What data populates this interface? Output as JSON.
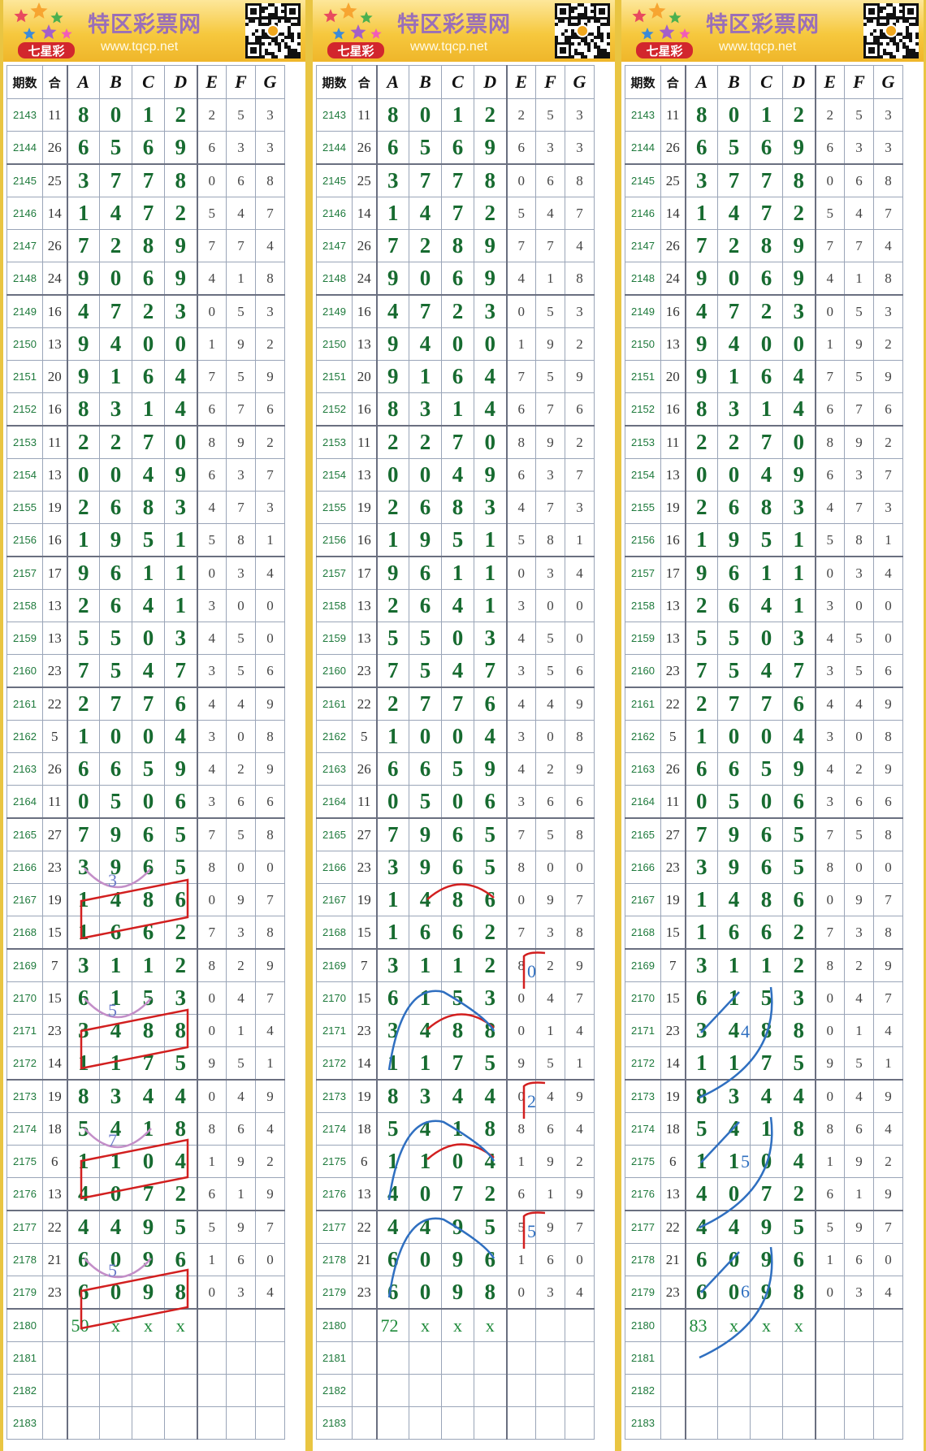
{
  "banner": {
    "title": "特区彩票网",
    "url": "www.tqcp.net",
    "logo_text": "七星彩",
    "logo_icon": "colorful-stars-logo",
    "qr_icon": "qr-code-icon"
  },
  "colors": {
    "digit_green": "#176b30",
    "period_green": "#1e7a3c",
    "banner_gold": "#efb62a",
    "annotation_red": "#d21f1f",
    "annotation_pink": "#c38ec8",
    "annotation_blue": "#2f6fc0"
  },
  "headers": [
    "期数",
    "合",
    "A",
    "B",
    "C",
    "D",
    "E",
    "F",
    "G"
  ],
  "rows": [
    {
      "p": "2143",
      "s": "11",
      "d": [
        "8",
        "0",
        "1",
        "2",
        "2",
        "5",
        "3"
      ]
    },
    {
      "p": "2144",
      "s": "26",
      "d": [
        "6",
        "5",
        "6",
        "9",
        "6",
        "3",
        "3"
      ]
    },
    {
      "p": "2145",
      "s": "25",
      "d": [
        "3",
        "7",
        "7",
        "8",
        "0",
        "6",
        "8"
      ]
    },
    {
      "p": "2146",
      "s": "14",
      "d": [
        "1",
        "4",
        "7",
        "2",
        "5",
        "4",
        "7"
      ]
    },
    {
      "p": "2147",
      "s": "26",
      "d": [
        "7",
        "2",
        "8",
        "9",
        "7",
        "7",
        "4"
      ]
    },
    {
      "p": "2148",
      "s": "24",
      "d": [
        "9",
        "0",
        "6",
        "9",
        "4",
        "1",
        "8"
      ]
    },
    {
      "p": "2149",
      "s": "16",
      "d": [
        "4",
        "7",
        "2",
        "3",
        "0",
        "5",
        "3"
      ]
    },
    {
      "p": "2150",
      "s": "13",
      "d": [
        "9",
        "4",
        "0",
        "0",
        "1",
        "9",
        "2"
      ]
    },
    {
      "p": "2151",
      "s": "20",
      "d": [
        "9",
        "1",
        "6",
        "4",
        "7",
        "5",
        "9"
      ]
    },
    {
      "p": "2152",
      "s": "16",
      "d": [
        "8",
        "3",
        "1",
        "4",
        "6",
        "7",
        "6"
      ]
    },
    {
      "p": "2153",
      "s": "11",
      "d": [
        "2",
        "2",
        "7",
        "0",
        "8",
        "9",
        "2"
      ]
    },
    {
      "p": "2154",
      "s": "13",
      "d": [
        "0",
        "0",
        "4",
        "9",
        "6",
        "3",
        "7"
      ]
    },
    {
      "p": "2155",
      "s": "19",
      "d": [
        "2",
        "6",
        "8",
        "3",
        "4",
        "7",
        "3"
      ]
    },
    {
      "p": "2156",
      "s": "16",
      "d": [
        "1",
        "9",
        "5",
        "1",
        "5",
        "8",
        "1"
      ]
    },
    {
      "p": "2157",
      "s": "17",
      "d": [
        "9",
        "6",
        "1",
        "1",
        "0",
        "3",
        "4"
      ]
    },
    {
      "p": "2158",
      "s": "13",
      "d": [
        "2",
        "6",
        "4",
        "1",
        "3",
        "0",
        "0"
      ]
    },
    {
      "p": "2159",
      "s": "13",
      "d": [
        "5",
        "5",
        "0",
        "3",
        "4",
        "5",
        "0"
      ]
    },
    {
      "p": "2160",
      "s": "23",
      "d": [
        "7",
        "5",
        "4",
        "7",
        "3",
        "5",
        "6"
      ]
    },
    {
      "p": "2161",
      "s": "22",
      "d": [
        "2",
        "7",
        "7",
        "6",
        "4",
        "4",
        "9"
      ]
    },
    {
      "p": "2162",
      "s": "5",
      "d": [
        "1",
        "0",
        "0",
        "4",
        "3",
        "0",
        "8"
      ]
    },
    {
      "p": "2163",
      "s": "26",
      "d": [
        "6",
        "6",
        "5",
        "9",
        "4",
        "2",
        "9"
      ]
    },
    {
      "p": "2164",
      "s": "11",
      "d": [
        "0",
        "5",
        "0",
        "6",
        "3",
        "6",
        "6"
      ]
    },
    {
      "p": "2165",
      "s": "27",
      "d": [
        "7",
        "9",
        "6",
        "5",
        "7",
        "5",
        "8"
      ]
    },
    {
      "p": "2166",
      "s": "23",
      "d": [
        "3",
        "9",
        "6",
        "5",
        "8",
        "0",
        "0"
      ]
    },
    {
      "p": "2167",
      "s": "19",
      "d": [
        "1",
        "4",
        "8",
        "6",
        "0",
        "9",
        "7"
      ]
    },
    {
      "p": "2168",
      "s": "15",
      "d": [
        "1",
        "6",
        "6",
        "2",
        "7",
        "3",
        "8"
      ]
    },
    {
      "p": "2169",
      "s": "7",
      "d": [
        "3",
        "1",
        "1",
        "2",
        "8",
        "2",
        "9"
      ]
    },
    {
      "p": "2170",
      "s": "15",
      "d": [
        "6",
        "1",
        "5",
        "3",
        "0",
        "4",
        "7"
      ]
    },
    {
      "p": "2171",
      "s": "23",
      "d": [
        "3",
        "4",
        "8",
        "8",
        "0",
        "1",
        "4"
      ]
    },
    {
      "p": "2172",
      "s": "14",
      "d": [
        "1",
        "1",
        "7",
        "5",
        "9",
        "5",
        "1"
      ]
    },
    {
      "p": "2173",
      "s": "19",
      "d": [
        "8",
        "3",
        "4",
        "4",
        "0",
        "4",
        "9"
      ]
    },
    {
      "p": "2174",
      "s": "18",
      "d": [
        "5",
        "4",
        "1",
        "8",
        "8",
        "6",
        "4"
      ]
    },
    {
      "p": "2175",
      "s": "6",
      "d": [
        "1",
        "1",
        "0",
        "4",
        "1",
        "9",
        "2"
      ]
    },
    {
      "p": "2176",
      "s": "13",
      "d": [
        "4",
        "0",
        "7",
        "2",
        "6",
        "1",
        "9"
      ]
    },
    {
      "p": "2177",
      "s": "22",
      "d": [
        "4",
        "4",
        "9",
        "5",
        "5",
        "9",
        "7"
      ]
    },
    {
      "p": "2178",
      "s": "21",
      "d": [
        "6",
        "0",
        "9",
        "6",
        "1",
        "6",
        "0"
      ]
    },
    {
      "p": "2179",
      "s": "23",
      "d": [
        "6",
        "0",
        "9",
        "8",
        "0",
        "3",
        "4"
      ]
    }
  ],
  "empty_periods": [
    "2181",
    "2182",
    "2183"
  ],
  "panels": [
    {
      "id": "panel-1",
      "prediction": {
        "period": "2180",
        "marks": [
          "50",
          "x",
          "x",
          "x"
        ]
      },
      "notes": [
        "3",
        "5",
        "7",
        "5"
      ]
    },
    {
      "id": "panel-2",
      "prediction": {
        "period": "2180",
        "marks": [
          "72",
          "x",
          "x",
          "x"
        ]
      },
      "notes": [
        "0",
        "2",
        "5"
      ]
    },
    {
      "id": "panel-3",
      "prediction": {
        "period": "2180",
        "marks": [
          "83",
          "x",
          "x",
          "x"
        ]
      },
      "notes": [
        "4",
        "5",
        "6"
      ]
    }
  ]
}
